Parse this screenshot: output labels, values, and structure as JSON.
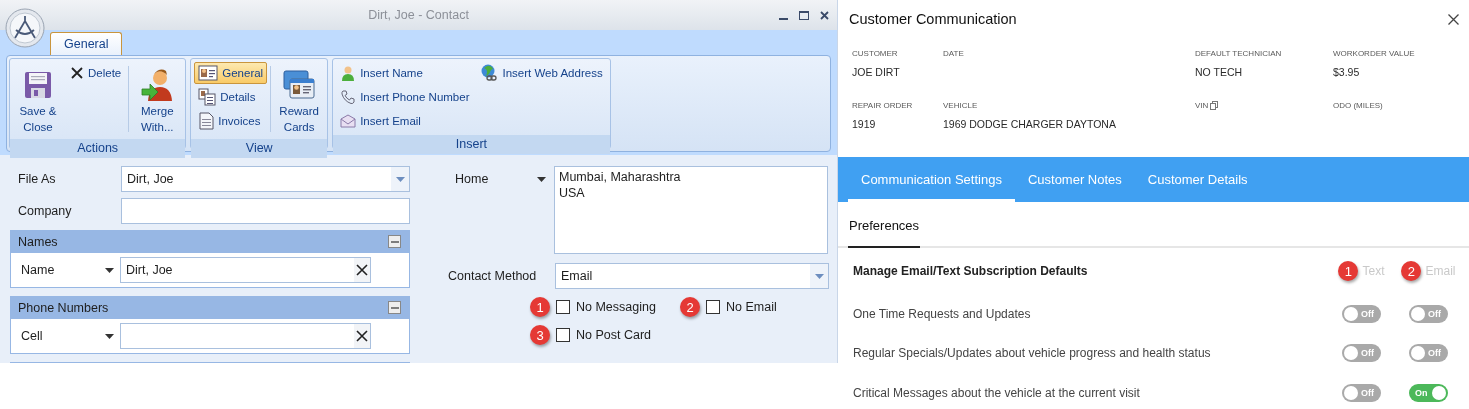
{
  "window": {
    "title": "Dirt, Joe - Contact"
  },
  "ribbon_tabs": [
    {
      "label": "General",
      "selected": true
    }
  ],
  "ribbon_groups": [
    {
      "label": "Actions",
      "items": [
        {
          "kind": "large",
          "label": "Save & Close"
        },
        {
          "kind": "small",
          "label": "Delete"
        },
        {
          "kind": "large",
          "label": "Merge With..."
        }
      ]
    },
    {
      "label": "View",
      "items": [
        {
          "kind": "small",
          "label": "General",
          "selected": true
        },
        {
          "kind": "small",
          "label": "Details",
          "selected": false
        },
        {
          "kind": "small",
          "label": "Invoices",
          "selected": false
        },
        {
          "kind": "large",
          "label": "Reward Cards",
          "selected": false
        }
      ]
    },
    {
      "label": "Insert",
      "items": [
        {
          "kind": "small",
          "label": "Insert Name"
        },
        {
          "kind": "small",
          "label": "Insert Phone Number"
        },
        {
          "kind": "small",
          "label": "Insert Email"
        },
        {
          "kind": "small",
          "label": "Insert Web Address"
        }
      ]
    }
  ],
  "form": {
    "file_as": {
      "label": "File As",
      "value": "Dirt, Joe"
    },
    "company": {
      "label": "Company"
    },
    "sections": [
      {
        "title": "Names",
        "expanded": true,
        "rows": [
          {
            "type": "Name",
            "value": "Dirt, Joe"
          }
        ]
      },
      {
        "title": "Phone Numbers",
        "expanded": true,
        "rows": [
          {
            "type": "Cell"
          }
        ]
      }
    ],
    "address": {
      "type": "Home",
      "value": "Mumbai, Maharashtra\nUSA"
    },
    "contact_method": {
      "label": "Contact Method",
      "value": "Email"
    },
    "options": [
      {
        "label": "No Messaging",
        "checked": false,
        "badge": "1"
      },
      {
        "label": "No Email",
        "checked": false,
        "badge": "2"
      },
      {
        "label": "No Post Card",
        "checked": false,
        "badge": "3"
      }
    ]
  },
  "comm": {
    "title": "Customer Communication",
    "info": [
      {
        "kind": "plain",
        "label": "CUSTOMER",
        "value": "JOE DIRT"
      },
      {
        "kind": "plain",
        "label": "DATE"
      },
      {
        "kind": "plain",
        "label": "DEFAULT TECHNICIAN",
        "value": "NO TECH"
      },
      {
        "kind": "plain",
        "label": "WORKORDER VALUE",
        "value": "$3.95"
      },
      {
        "kind": "plain",
        "label": "REPAIR ORDER",
        "value": "1919"
      },
      {
        "kind": "plain",
        "label": "VEHICLE",
        "value": "1969 DODGE CHARGER DAYTONA"
      },
      {
        "kind": "copyable",
        "label": "VIN"
      },
      {
        "kind": "plain",
        "label": "ODO (MILES)"
      }
    ],
    "tabs": [
      {
        "label": "Communication Settings",
        "selected": true
      },
      {
        "label": "Customer Notes",
        "selected": false
      },
      {
        "label": "Customer Details",
        "selected": false
      }
    ],
    "subtabs": [
      {
        "label": "Preferences",
        "selected": true
      }
    ],
    "subscription": {
      "heading": "Manage Email/Text Subscription Defaults",
      "channels": [
        {
          "label": "Text",
          "badge": "1"
        },
        {
          "label": "Email",
          "badge": "2"
        }
      ],
      "rows": [
        {
          "label": "One Time Requests and Updates",
          "toggles": [
            {
              "on": false,
              "label": "Off"
            },
            {
              "on": false,
              "label": "Off"
            }
          ]
        },
        {
          "label": "Regular Specials/Updates about vehicle progress and health status",
          "toggles": [
            {
              "on": false,
              "label": "Off"
            },
            {
              "on": false,
              "label": "Off"
            }
          ]
        },
        {
          "label": "Critical Messages about the vehicle at the current visit",
          "toggles": [
            {
              "on": false,
              "label": "Off"
            },
            {
              "on": true,
              "label": "On"
            }
          ]
        }
      ]
    }
  }
}
